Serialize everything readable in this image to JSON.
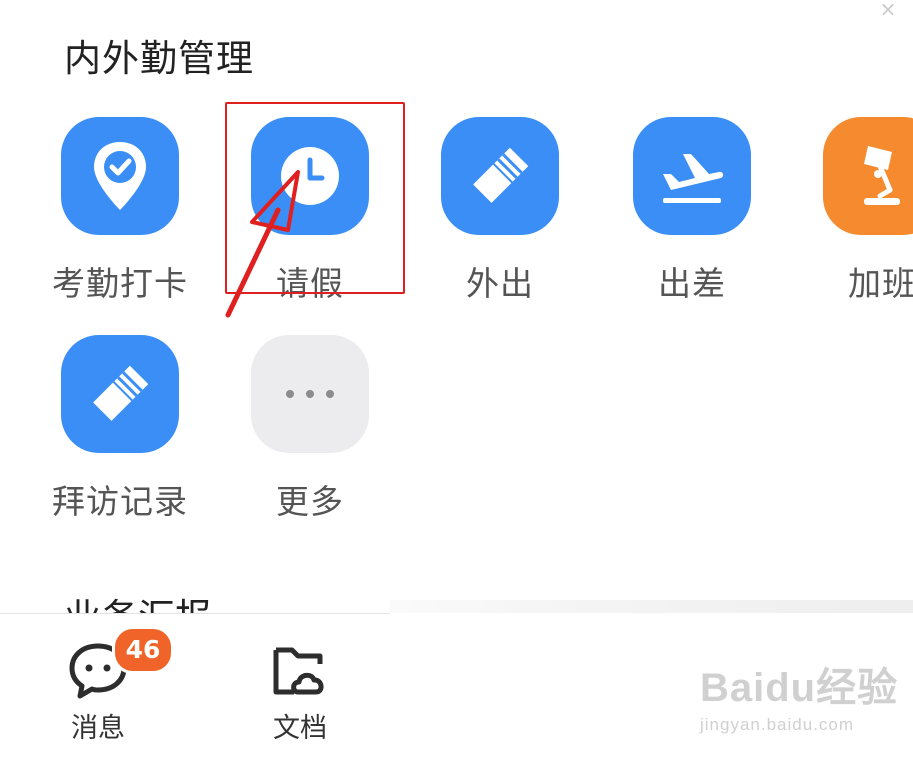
{
  "header": {
    "title": "内外勤管理",
    "close_glyph": "×"
  },
  "apps": [
    {
      "label": "考勤打卡",
      "icon": "location-check-icon",
      "color": "#3a8ef6"
    },
    {
      "label": "请假",
      "icon": "clock-icon",
      "color": "#3a8ef6"
    },
    {
      "label": "外出",
      "icon": "eraser-icon",
      "color": "#3a8ef6"
    },
    {
      "label": "出差",
      "icon": "airplane-takeoff-icon",
      "color": "#3a8ef6"
    },
    {
      "label": "加班",
      "icon": "desk-lamp-icon",
      "color": "#f58a2e"
    },
    {
      "label": "拜访记录",
      "icon": "eraser-icon",
      "color": "#3a8ef6"
    },
    {
      "label": "更多",
      "icon": "more-dots-icon",
      "color": "#ececee"
    }
  ],
  "section2": {
    "title": "业务汇报"
  },
  "bottom_nav": {
    "items": [
      {
        "label": "消息",
        "icon": "chat-bubble-icon",
        "badge": "46"
      },
      {
        "label": "文档",
        "icon": "folder-cloud-icon"
      }
    ]
  },
  "watermark": {
    "main": "Baidu经验",
    "sub": "jingyan.baidu.com"
  },
  "annotation": {
    "highlight_color": "#e02020"
  }
}
